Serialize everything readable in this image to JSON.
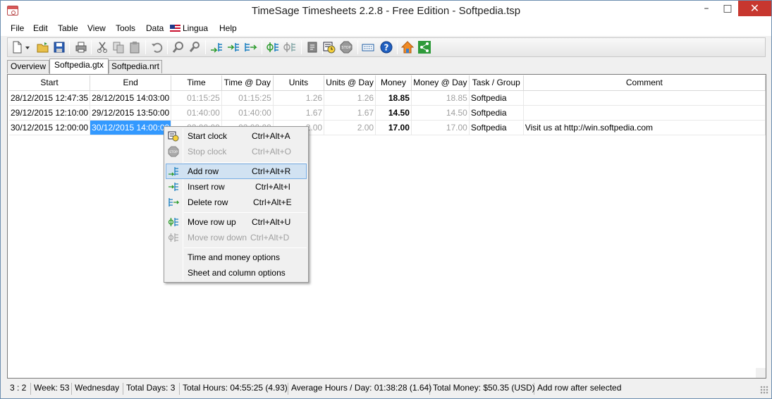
{
  "window": {
    "title": "TimeSage Timesheets 2.2.8 - Free Edition - Softpedia.tsp",
    "minimize_icon": "minimize-icon",
    "maximize_icon": "maximize-icon",
    "close_icon": "close-icon"
  },
  "menubar": {
    "items": [
      "File",
      "Edit",
      "Table",
      "View",
      "Tools",
      "Data",
      "Lingua",
      "Help"
    ]
  },
  "toolbar": {
    "icons": [
      "new-document-icon",
      "dropdown-arrow-icon",
      "open-folder-icon",
      "save-icon",
      "print-icon",
      "cut-icon",
      "copy-icon",
      "paste-icon",
      "undo-icon",
      "find-icon",
      "replace-icon",
      "add-row-icon",
      "insert-row-icon",
      "delete-row-icon",
      "move-row-up-icon",
      "move-row-down-icon",
      "notes-icon",
      "start-clock-icon",
      "stop-clock-icon",
      "keyboard-icon",
      "help-icon",
      "home-icon",
      "share-icon"
    ]
  },
  "tabs": [
    {
      "label": "Overview",
      "active": false
    },
    {
      "label": "Softpedia.gtx",
      "active": true
    },
    {
      "label": "Softpedia.nrt",
      "active": false
    }
  ],
  "grid": {
    "columns": [
      "Start",
      "End",
      "Time",
      "Time @ Day",
      "Units",
      "Units @ Day",
      "Money",
      "Money @ Day",
      "Task / Group",
      "Comment"
    ],
    "rows": [
      {
        "start": "28/12/2015 12:47:35",
        "end": "28/12/2015 14:03:00",
        "time": "01:15:25",
        "time_day": "01:15:25",
        "units": "1.26",
        "units_day": "1.26",
        "money": "18.85",
        "money_day": "18.85",
        "task": "Softpedia",
        "comment": ""
      },
      {
        "start": "29/12/2015 12:10:00",
        "end": "29/12/2015 13:50:00",
        "time": "01:40:00",
        "time_day": "01:40:00",
        "units": "1.67",
        "units_day": "1.67",
        "money": "14.50",
        "money_day": "14.50",
        "task": "Softpedia",
        "comment": ""
      },
      {
        "start": "30/12/2015 12:00:00",
        "end": "30/12/2015 14:00:00",
        "time": "02:00:00",
        "time_day": "02:00:00",
        "units": "2.00",
        "units_day": "2.00",
        "money": "17.00",
        "money_day": "17.00",
        "task": "Softpedia",
        "comment": "Visit us at http://win.softpedia.com"
      }
    ]
  },
  "context_menu": {
    "items": [
      {
        "label": "Start clock",
        "shortcut": "Ctrl+Alt+A",
        "icon": "start-clock-icon",
        "disabled": false
      },
      {
        "label": "Stop clock",
        "shortcut": "Ctrl+Alt+O",
        "icon": "stop-clock-icon",
        "disabled": true
      },
      {
        "label": "Add row",
        "shortcut": "Ctrl+Alt+R",
        "icon": "add-row-icon",
        "disabled": false,
        "highlighted": true
      },
      {
        "label": "Insert row",
        "shortcut": "Ctrl+Alt+I",
        "icon": "insert-row-icon",
        "disabled": false
      },
      {
        "label": "Delete row",
        "shortcut": "Ctrl+Alt+E",
        "icon": "delete-row-icon",
        "disabled": false
      },
      {
        "label": "Move row up",
        "shortcut": "Ctrl+Alt+U",
        "icon": "move-row-up-icon",
        "disabled": false
      },
      {
        "label": "Move row down",
        "shortcut": "Ctrl+Alt+D",
        "icon": "move-row-down-icon",
        "disabled": true
      },
      {
        "label": "Time and money options",
        "shortcut": "",
        "icon": "",
        "disabled": false
      },
      {
        "label": "Sheet and column options",
        "shortcut": "",
        "icon": "",
        "disabled": false
      }
    ]
  },
  "statusbar": {
    "position": "3 : 2",
    "week": "Week: 53",
    "day": "Wednesday",
    "total_days": "Total Days: 3",
    "total_hours": "Total Hours: 04:55:25 (4.93)",
    "average_hours": "Average Hours / Day: 01:38:28 (1.64)",
    "total_money": "Total Money: $50.35 (USD)",
    "message": "Add row after selected"
  },
  "colors": {
    "selection": "#3399ff",
    "menu_highlight": "#d1e2f2",
    "close_button": "#c7372f"
  }
}
